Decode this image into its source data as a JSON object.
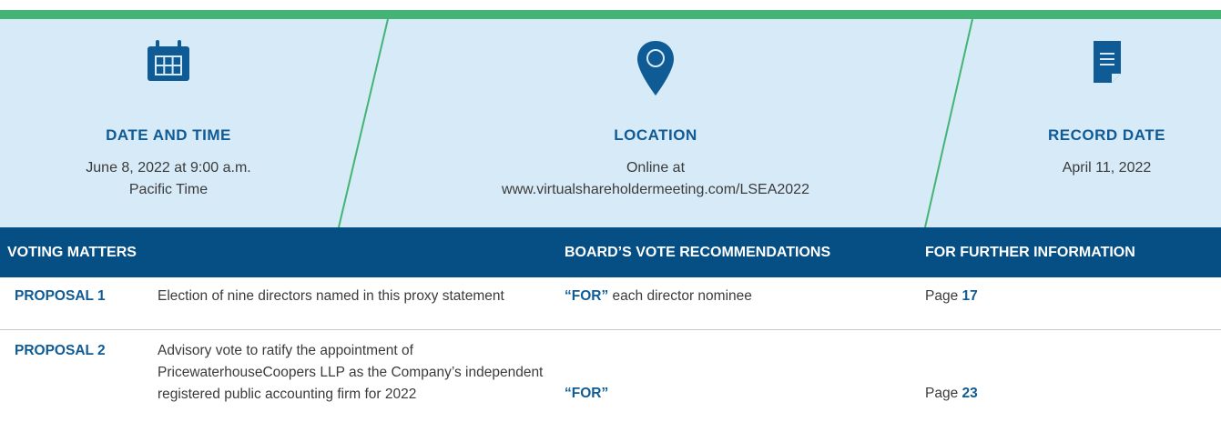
{
  "summary": {
    "date_time": {
      "icon": "calendar-icon",
      "heading": "DATE AND TIME",
      "line1": "June 8, 2022 at 9:00 a.m.",
      "line2": "Pacific Time"
    },
    "location": {
      "icon": "map-pin-icon",
      "heading": "LOCATION",
      "line1": "Online at",
      "line2": "www.virtualshareholdermeeting.com/LSEA2022"
    },
    "record_date": {
      "icon": "document-icon",
      "heading": "RECORD DATE",
      "line1": "April 11, 2022"
    }
  },
  "table": {
    "headers": [
      "VOTING MATTERS",
      "BOARD’S VOTE RECOMMENDATIONS",
      "FOR FURTHER INFORMATION"
    ],
    "rows": [
      {
        "proposal": "PROPOSAL 1",
        "description": "Election of nine directors named in this proxy statement",
        "recommendation": "“FOR”",
        "recommendation_suffix": " each director nominee",
        "page_prefix": "Page ",
        "page_number": "17"
      },
      {
        "proposal": "PROPOSAL 2",
        "description": "Advisory vote to ratify the appointment of PricewaterhouseCoopers LLP as the Company’s independent registered public accounting firm for 2022",
        "recommendation": "“FOR”",
        "recommendation_suffix": "",
        "page_prefix": "Page ",
        "page_number": "23"
      }
    ]
  },
  "colors": {
    "accent_green": "#43b473",
    "panel_blue": "#d7eaf7",
    "header_navy": "#064f85",
    "text_blue": "#0f5b96"
  }
}
